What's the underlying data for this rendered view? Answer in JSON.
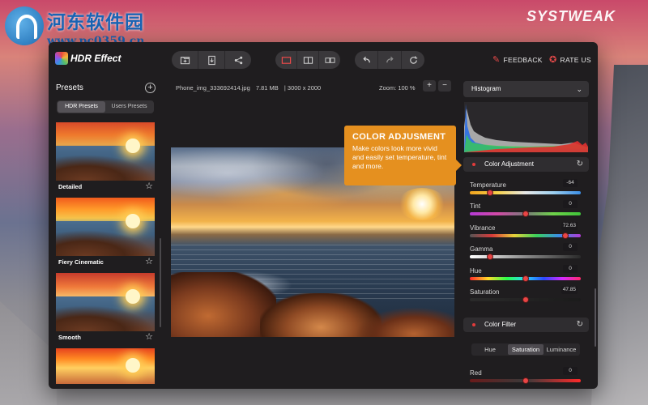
{
  "watermark": {
    "title": "河东软件园",
    "url": "www.pc0359.cn"
  },
  "desktop_brand": "SYSTWEAK",
  "app": {
    "name": "HDR Effect"
  },
  "toolbar": {
    "group1": [
      {
        "icon": "folder-open-icon"
      },
      {
        "icon": "export-icon"
      },
      {
        "icon": "share-icon"
      }
    ],
    "group2": [
      {
        "icon": "single-view-icon"
      },
      {
        "icon": "split-view-icon"
      },
      {
        "icon": "side-by-side-icon"
      }
    ],
    "group3": [
      {
        "icon": "undo-icon"
      },
      {
        "icon": "redo-icon"
      },
      {
        "icon": "reset-icon"
      }
    ],
    "feedback_label": "FEEDBACK",
    "rate_label": "RATE US"
  },
  "sidebar": {
    "title": "Presets",
    "tabs": [
      {
        "label": "HDR Presets",
        "active": true
      },
      {
        "label": "Users Presets",
        "active": false
      }
    ],
    "presets": [
      {
        "label": "Detailed"
      },
      {
        "label": "Fiery Cinematic"
      },
      {
        "label": "Smooth"
      },
      {
        "label": ""
      }
    ]
  },
  "file": {
    "name": "Phone_img_333692414.jpg",
    "size": "7.81 MB",
    "dimensions": "3000 x 2000",
    "zoom": "Zoom: 100 %",
    "zoom_in": "+",
    "zoom_out": "−"
  },
  "tooltip": {
    "title": "COLOR ADJUSMENT",
    "body": "Make colors look more vivid and easily set temperature, tint and more."
  },
  "right_panel": {
    "histogram_label": "Histogram",
    "color_adjustment": {
      "label": "Color Adjustment",
      "sliders": [
        {
          "label": "Temperature",
          "value": "-64",
          "position": 0.18
        },
        {
          "label": "Tint",
          "value": "0",
          "position": 0.5
        },
        {
          "label": "Vibrance",
          "value": "72.63",
          "position": 0.86
        },
        {
          "label": "Gamma",
          "value": "0",
          "position": 0.18
        },
        {
          "label": "Hue",
          "value": "0",
          "position": 0.5
        },
        {
          "label": "Saturation",
          "value": "47.85",
          "position": 0.5
        }
      ]
    },
    "color_filter": {
      "label": "Color Filter",
      "tabs": [
        {
          "label": "Hue",
          "active": false
        },
        {
          "label": "Saturation",
          "active": true
        },
        {
          "label": "Luminance",
          "active": false
        }
      ],
      "sliders": [
        {
          "label": "Red",
          "value": "0",
          "position": 0.5
        }
      ]
    }
  },
  "colors": {
    "accent": "#e5901f",
    "slider_knob": "#e94545",
    "window_bg": "#1f1d1f"
  }
}
